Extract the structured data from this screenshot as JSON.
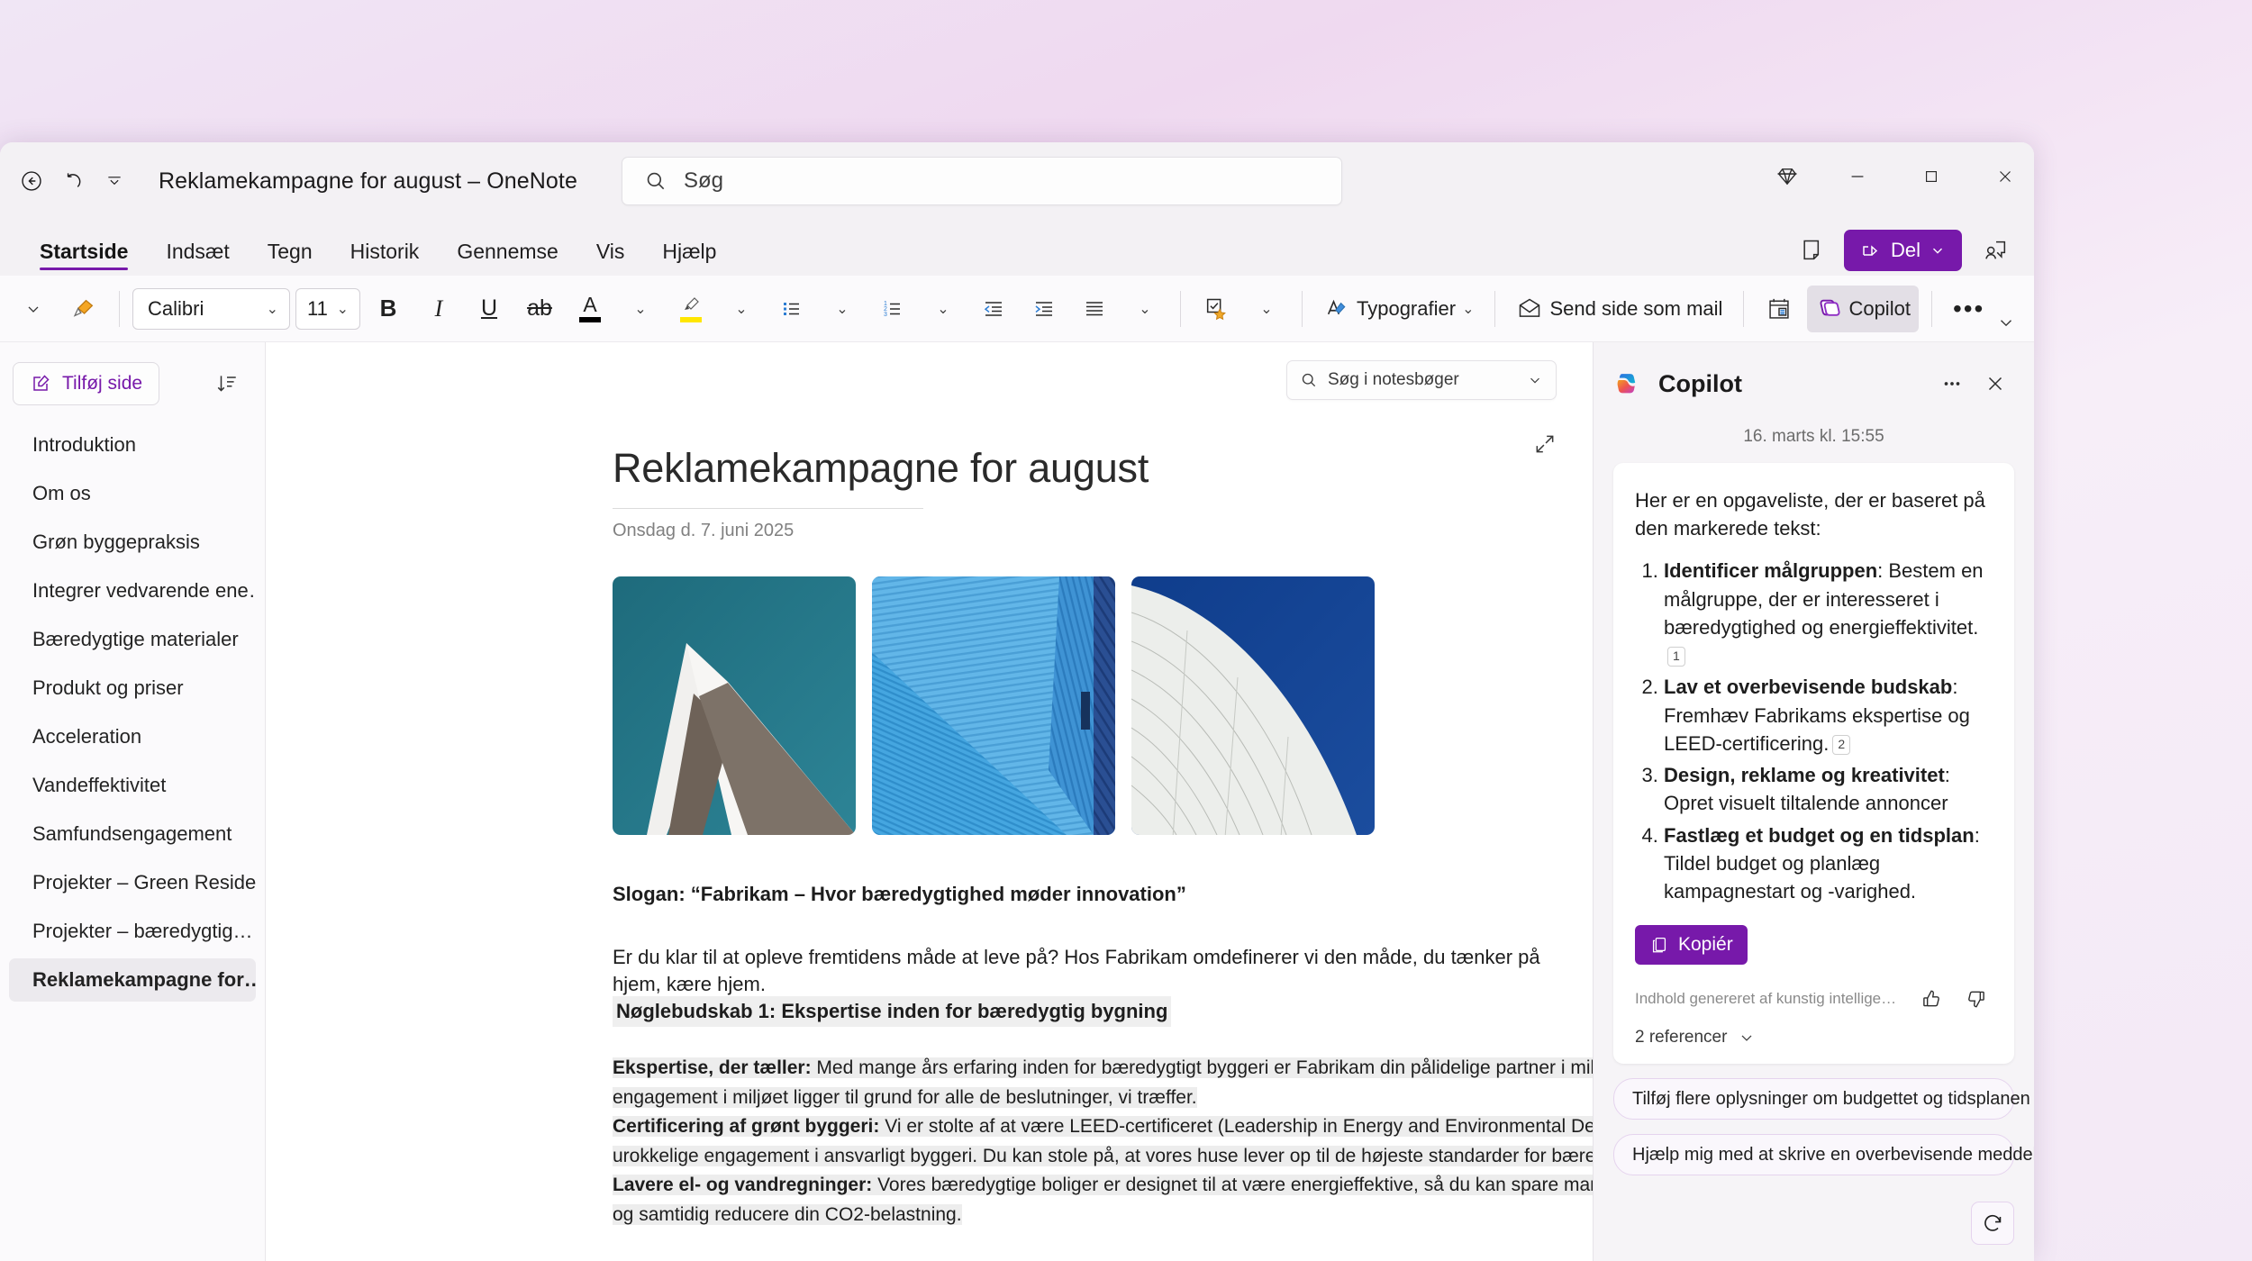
{
  "titlebar": {
    "title": "Reklamekampagne for august – OneNote",
    "back_icon": "back-arrow-icon",
    "undo_icon": "undo-icon",
    "customize_icon": "chevron-down-icon",
    "search_placeholder": "Søg",
    "search_icon": "search-icon",
    "avatar_name": "user-avatar",
    "diamond_icon": "diamond-icon",
    "minimize_label": "–",
    "maximize_label": "□",
    "close_label": "✕"
  },
  "ribbon": {
    "tabs": [
      {
        "label": "Startside",
        "active": true
      },
      {
        "label": "Indsæt",
        "active": false
      },
      {
        "label": "Tegn",
        "active": false
      },
      {
        "label": "Historik",
        "active": false
      },
      {
        "label": "Gennemse",
        "active": false
      },
      {
        "label": "Vis",
        "active": false
      },
      {
        "label": "Hjælp",
        "active": false
      }
    ],
    "notes_icon": "sticky-note-icon",
    "share_label": "Del",
    "share_icon": "share-icon",
    "share_chevron": "chevron-down-icon",
    "comment_icon": "add-comment-icon",
    "collapse_icon": "chevron-down-icon"
  },
  "toolbar": {
    "more_clipboard_chevron": "chevron-down-icon",
    "format_painter_icon": "format-painter-icon",
    "font_family": "Calibri",
    "font_size": "11",
    "bold_label": "B",
    "italic_label": "I",
    "underline_label": "U",
    "strikethrough_label": "ab",
    "font_color_label": "A",
    "highlight_icon": "highlighter-icon",
    "bullets_icon": "bulleted-list-icon",
    "numbering_icon": "numbered-list-icon",
    "decrease_indent_icon": "decrease-indent-icon",
    "increase_indent_icon": "increase-indent-icon",
    "align_icon": "align-left-icon",
    "tags_icon": "tag-star-icon",
    "styles_label": "Typografier",
    "styles_icon": "styles-icon",
    "email_page_label": "Send side som mail",
    "email_icon": "envelope-icon",
    "meeting_icon": "meeting-details-icon",
    "copilot_label": "Copilot",
    "copilot_icon": "copilot-icon",
    "overflow_label": "•••"
  },
  "sidebar": {
    "add_page_label": "Tilføj side",
    "add_page_icon": "new-page-icon",
    "sort_icon": "sort-icon",
    "pages": [
      {
        "label": "Introduktion",
        "selected": false
      },
      {
        "label": "Om os",
        "selected": false
      },
      {
        "label": "Grøn byggepraksis",
        "selected": false
      },
      {
        "label": "Integrer vedvarende ene…",
        "selected": false
      },
      {
        "label": "Bæredygtige materialer",
        "selected": false
      },
      {
        "label": "Produkt og priser",
        "selected": false
      },
      {
        "label": "Acceleration",
        "selected": false
      },
      {
        "label": "Vandeffektivitet",
        "selected": false
      },
      {
        "label": "Samfundsengagement",
        "selected": false
      },
      {
        "label": "Projekter – Green Reside…",
        "selected": false
      },
      {
        "label": "Projekter – bæredygtig…",
        "selected": false
      },
      {
        "label": "Reklamekampagne for…",
        "selected": true
      }
    ]
  },
  "document": {
    "notebook_search_placeholder": "Søg i notesbøger",
    "notebook_search_icon": "search-icon",
    "notebook_search_chevron": "chevron-down-icon",
    "expand_icon": "expand-page-icon",
    "title": "Reklamekampagne for august",
    "date": "Onsdag d. 7. juni 2025",
    "images": [
      {
        "name": "photo-white-roof-teal-sky"
      },
      {
        "name": "photo-blue-facade"
      },
      {
        "name": "photo-curved-white-building"
      }
    ],
    "slogan": "Slogan: “Fabrikam – Hvor bæredygtighed møder innovation”",
    "intro": "Er du klar til at opleve fremtidens måde at leve på? Hos Fabrikam omdefinerer vi den måde, du tænker på hjem, kære hjem.",
    "key_heading": "Nøglebudskab 1: Ekspertise inden for bæredygtig bygning",
    "paragraphs": [
      {
        "lead": "Ekspertise, der tæller:",
        "text": " Med mange års erfaring inden for bæredygtigt byggeri er Fabrikam din pålidelige partner i miljøbevidst levevis. Vores engagement i miljøet ligger til grund for alle de beslutninger, vi træffer."
      },
      {
        "lead": "Certificering af grønt byggeri:",
        "text": " Vi er stolte af at være LEED-certificeret (Leadership in Energy and Environmental Design), et symbol på vores urokkelige engagement i ansvarligt byggeri. Du kan stole på, at vores huse lever op til de højeste standarder for bæredygtighed."
      },
      {
        "lead": "Lavere el- og vandregninger:",
        "text": " Vores bæredygtige boliger er designet til at være energieffektive, så du kan spare mange penge på elregningen og samtidig reducere din CO2-belastning."
      }
    ]
  },
  "copilot": {
    "title": "Copilot",
    "logo_icon": "copilot-icon",
    "more_icon": "more-options-icon",
    "close_icon": "close-icon",
    "timestamp": "16. marts kl. 15:55",
    "intro": "Her er en opgaveliste, der er baseret på den markerede tekst:",
    "items": [
      {
        "lead": "Identificer målgruppen",
        "text": ": Bestem en målgruppe, der er interesseret i bæredygtighed og energieffektivitet.",
        "ref": "1"
      },
      {
        "lead": "Lav et overbevisende budskab",
        "text": ": Fremhæv Fabrikams ekspertise og LEED-certificering.",
        "ref": "2"
      },
      {
        "lead": "Design, reklame og kreativitet",
        "text": ": Opret visuelt tiltalende annoncer",
        "ref": ""
      },
      {
        "lead": "Fastlæg et budget og en tidsplan",
        "text": ": Tildel budget og planlæg kampagnestart og -varighed.",
        "ref": ""
      }
    ],
    "copy_label": "Kopiér",
    "copy_icon": "copy-icon",
    "disclaimer": "Indhold genereret af kunstig intelligens kan...",
    "thumbs_up_icon": "thumbs-up-icon",
    "thumbs_down_icon": "thumbs-down-icon",
    "references_label": "2 referencer",
    "references_chevron": "chevron-down-icon",
    "suggestions": [
      "Tilføj flere oplysninger om budgettet og tidsplanen",
      "Hjælp mig med at skrive en overbevisende meddelelse"
    ],
    "refresh_icon": "refresh-icon"
  },
  "colors": {
    "accent_purple": "#7719aa",
    "ribbon_bg": "#fbfafc",
    "pane_bg": "#f6f4f7"
  }
}
